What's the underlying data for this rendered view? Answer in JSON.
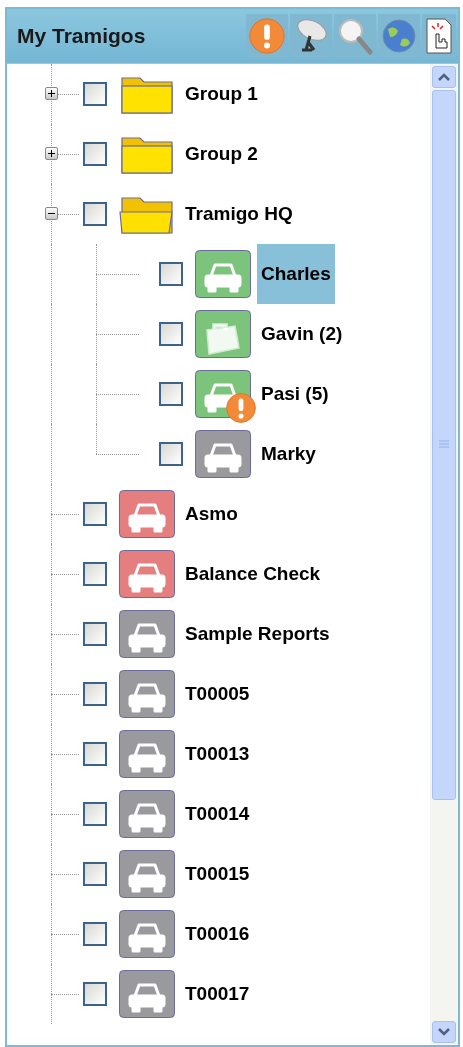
{
  "panel": {
    "title": "My Tramigos"
  },
  "tree": {
    "items": [
      {
        "kind": "folder",
        "label": "Group 1",
        "expanded": false,
        "checked": false,
        "selected": false,
        "alert": false
      },
      {
        "kind": "folder",
        "label": "Group 2",
        "expanded": false,
        "checked": false,
        "selected": false,
        "alert": false
      },
      {
        "kind": "folder",
        "label": "Tramigo HQ",
        "expanded": true,
        "checked": false,
        "selected": false,
        "alert": false,
        "children": [
          {
            "kind": "car",
            "label": "Charles",
            "color": "#7cc47c",
            "checked": false,
            "selected": true,
            "alert": false
          },
          {
            "kind": "bag",
            "label": "Gavin (2)",
            "color": "#7cc47c",
            "checked": false,
            "selected": false,
            "alert": false
          },
          {
            "kind": "car",
            "label": "Pasi (5)",
            "color": "#7cc47c",
            "checked": false,
            "selected": false,
            "alert": true
          },
          {
            "kind": "car",
            "label": "Marky",
            "color": "#9a9a9e",
            "checked": false,
            "selected": false,
            "alert": false
          }
        ]
      },
      {
        "kind": "car",
        "label": "Asmo",
        "color": "#e57f7f",
        "checked": false,
        "selected": false,
        "alert": false
      },
      {
        "kind": "car",
        "label": "Balance Check",
        "color": "#e57f7f",
        "checked": false,
        "selected": false,
        "alert": false
      },
      {
        "kind": "car",
        "label": "Sample Reports",
        "color": "#9a9a9e",
        "checked": false,
        "selected": false,
        "alert": false
      },
      {
        "kind": "car",
        "label": "T00005",
        "color": "#9a9a9e",
        "checked": false,
        "selected": false,
        "alert": false
      },
      {
        "kind": "car",
        "label": "T00013",
        "color": "#9a9a9e",
        "checked": false,
        "selected": false,
        "alert": false
      },
      {
        "kind": "car",
        "label": "T00014",
        "color": "#9a9a9e",
        "checked": false,
        "selected": false,
        "alert": false
      },
      {
        "kind": "car",
        "label": "T00015",
        "color": "#9a9a9e",
        "checked": false,
        "selected": false,
        "alert": false
      },
      {
        "kind": "car",
        "label": "T00016",
        "color": "#9a9a9e",
        "checked": false,
        "selected": false,
        "alert": false
      },
      {
        "kind": "car",
        "label": "T00017",
        "color": "#9a9a9e",
        "checked": false,
        "selected": false,
        "alert": false
      }
    ]
  }
}
